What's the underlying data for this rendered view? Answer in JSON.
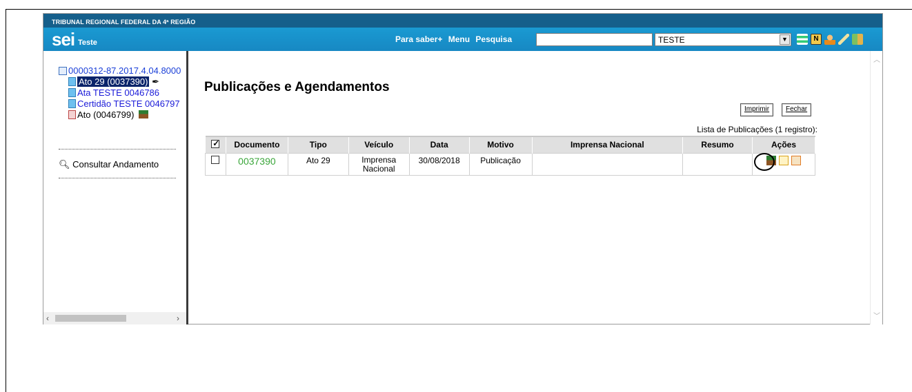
{
  "header": {
    "org": "TRIBUNAL REGIONAL FEDERAL DA 4ª REGIÃO",
    "logo": "sei",
    "logo_sub": "Teste",
    "links": [
      "Para saber+",
      "Menu",
      "Pesquisa"
    ],
    "search_value": "",
    "unit": "TESTE",
    "icons": [
      "list-icon",
      "notes-icon",
      "user-icon",
      "tools-icon",
      "exit-icon"
    ]
  },
  "sidebar": {
    "process": "0000312-87.2017.4.04.8000",
    "docs": [
      {
        "label": "Ato 29 (0037390)",
        "selected": true
      },
      {
        "label": "Ata TESTE 0046786",
        "selected": false
      },
      {
        "label": "Certidão TESTE 0046797",
        "selected": false
      },
      {
        "label": "Ato (0046799)",
        "selected": false
      }
    ],
    "consult": "Consultar Andamento"
  },
  "main": {
    "title": "Publicações e Agendamentos",
    "print_label": "Imprimir",
    "close_label": "Fechar",
    "caption": "Lista de Publicações (1 registro):",
    "columns": [
      "Documento",
      "Tipo",
      "Veículo",
      "Data",
      "Motivo",
      "Imprensa Nacional",
      "Resumo",
      "Ações"
    ],
    "rows": [
      {
        "documento": "0037390",
        "tipo": "Ato 29",
        "veiculo": "Imprensa Nacional",
        "data": "30/08/2018",
        "motivo": "Publicação",
        "imprensa": "",
        "resumo": ""
      }
    ]
  },
  "colors": {
    "topstrip": "#155f8b",
    "header": "#1a9ad2",
    "selected": "#0a246a",
    "doc_link": "#3aa63a"
  }
}
